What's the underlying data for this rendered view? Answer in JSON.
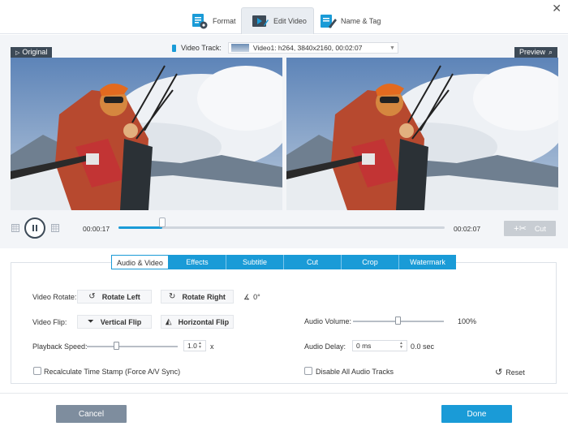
{
  "top_tabs": [
    {
      "label": "Format",
      "icon": "format-settings-icon"
    },
    {
      "label": "Edit Video",
      "icon": "edit-video-icon"
    },
    {
      "label": "Name & Tag",
      "icon": "name-tag-icon"
    }
  ],
  "preview": {
    "original_label": "Original",
    "preview_label": "Preview",
    "video_track_label": "Video Track:",
    "video_track_value": "Video1: h264, 3840x2160, 00:02:07"
  },
  "playback": {
    "current_time": "00:00:17",
    "total_time": "00:02:07",
    "progress_fraction": 0.134,
    "cut_label": "Cut"
  },
  "settings_tabs": [
    "Audio & Video",
    "Effects",
    "Subtitle",
    "Cut",
    "Crop",
    "Watermark"
  ],
  "audio_video": {
    "video_rotate_label": "Video Rotate:",
    "rotate_left": "Rotate Left",
    "rotate_right": "Rotate Right",
    "rotation_angle": "0°",
    "video_flip_label": "Video Flip:",
    "vertical_flip": "Vertical Flip",
    "horizontal_flip": "Horizontal Flip",
    "playback_speed_label": "Playback Speed:",
    "playback_speed_value": "1.0",
    "playback_speed_unit": "x",
    "playback_speed_fraction": 0.33,
    "audio_volume_label": "Audio Volume:",
    "audio_volume_value": "100%",
    "audio_volume_fraction": 0.5,
    "audio_delay_label": "Audio Delay:",
    "audio_delay_value": "0 ms",
    "audio_delay_sec": "0.0 sec",
    "recalc_label": "Recalculate Time Stamp (Force A/V Sync)",
    "disable_audio_label": "Disable All Audio Tracks",
    "reset_label": "Reset"
  },
  "footer": {
    "cancel": "Cancel",
    "done": "Done"
  },
  "colors": {
    "accent": "#1a9bd7",
    "dark_label": "#3d4a57",
    "cancel_bg": "#7e8d9e"
  }
}
